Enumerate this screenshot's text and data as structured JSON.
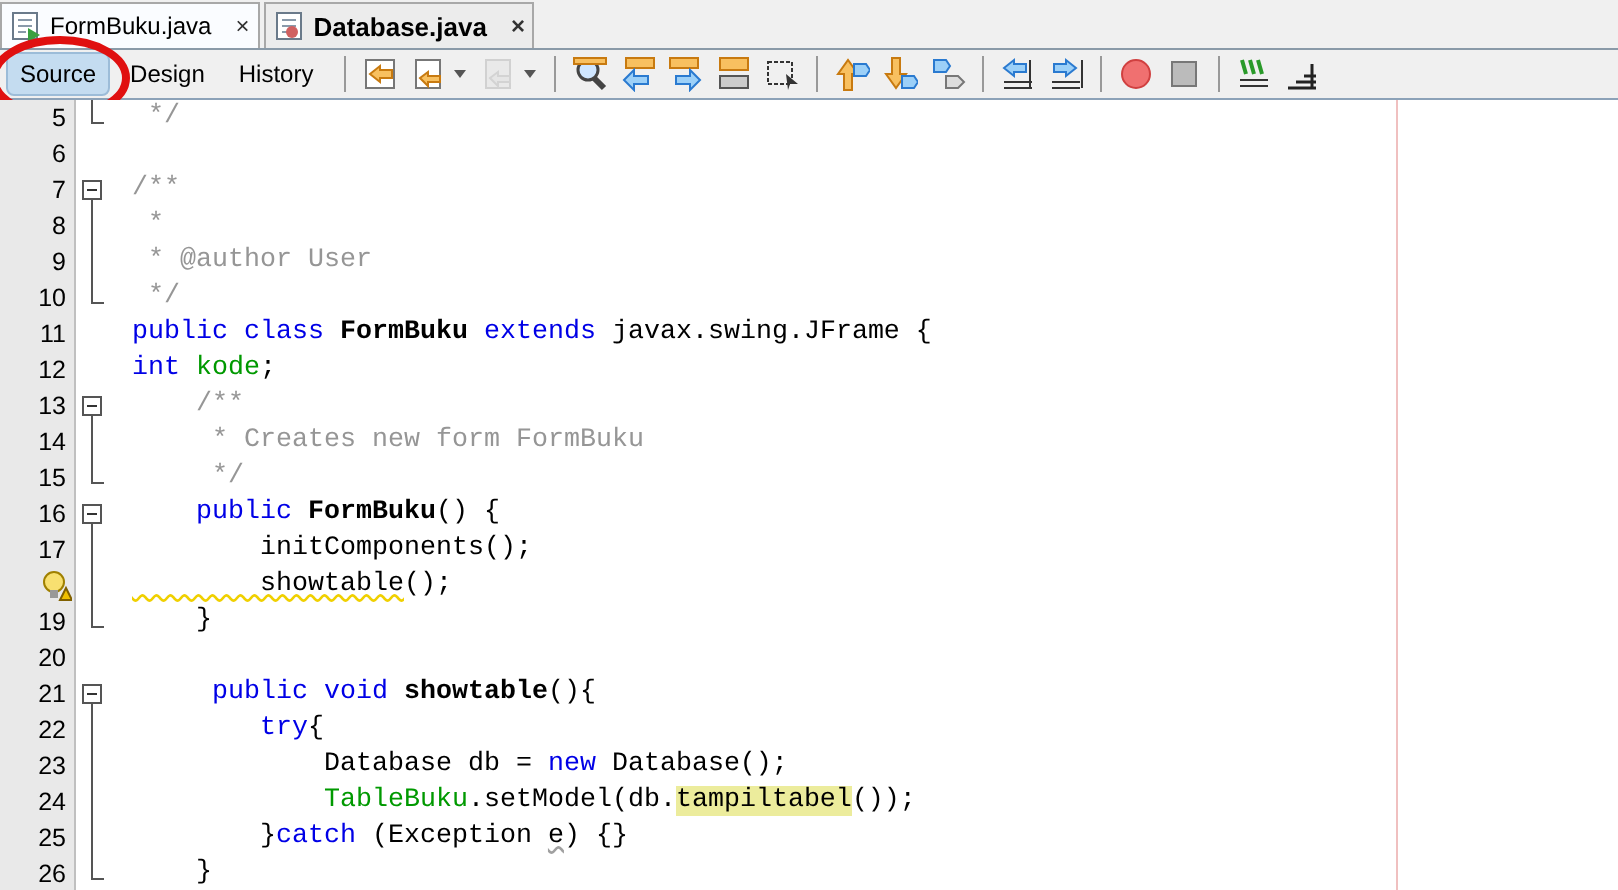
{
  "tabs": [
    {
      "label": "FormBuku.java",
      "selected": true,
      "modified": false,
      "close": "×"
    },
    {
      "label": "Database.java",
      "selected": false,
      "modified": true,
      "close": "×"
    }
  ],
  "views": [
    {
      "label": "Source",
      "selected": true
    },
    {
      "label": "Design",
      "selected": false
    },
    {
      "label": "History",
      "selected": false
    }
  ],
  "toolbar": [
    {
      "kind": "back",
      "disabled": false
    },
    {
      "kind": "prev-edit",
      "disabled": false,
      "dropdown": true
    },
    {
      "kind": "next-edit",
      "disabled": true,
      "dropdown": true
    },
    {
      "kind": "sep"
    },
    {
      "kind": "find",
      "disabled": false
    },
    {
      "kind": "find-prev",
      "disabled": false
    },
    {
      "kind": "find-next",
      "disabled": false
    },
    {
      "kind": "highlight",
      "disabled": false
    },
    {
      "kind": "select",
      "disabled": false
    },
    {
      "kind": "sep"
    },
    {
      "kind": "bm-prev",
      "disabled": false
    },
    {
      "kind": "bm-next",
      "disabled": false
    },
    {
      "kind": "bm-toggle",
      "disabled": false
    },
    {
      "kind": "sep"
    },
    {
      "kind": "shift-left",
      "disabled": false
    },
    {
      "kind": "shift-right",
      "disabled": false
    },
    {
      "kind": "sep"
    },
    {
      "kind": "record",
      "disabled": false
    },
    {
      "kind": "stop",
      "disabled": false
    },
    {
      "kind": "sep"
    },
    {
      "kind": "comment",
      "disabled": false
    },
    {
      "kind": "uncomment",
      "disabled": false
    }
  ],
  "lines": [
    {
      "number": "5",
      "kind": "fold-end",
      "tokens": [
        {
          "kind": "comment",
          "text": " */"
        }
      ]
    },
    {
      "number": "6"
    },
    {
      "number": "7",
      "kind": "fold-start",
      "tokens": [
        {
          "kind": "comment",
          "text": "/**"
        }
      ]
    },
    {
      "number": "8",
      "kind": "fold-line",
      "tokens": [
        {
          "kind": "comment",
          "text": " *"
        }
      ]
    },
    {
      "number": "9",
      "kind": "fold-line",
      "tokens": [
        {
          "kind": "comment",
          "text": " * @author User"
        }
      ]
    },
    {
      "number": "10",
      "kind": "fold-end",
      "tokens": [
        {
          "kind": "comment",
          "text": " */"
        }
      ]
    },
    {
      "number": "11",
      "tokens": [
        {
          "kind": "keyword",
          "text": "public class "
        },
        {
          "kind": "name",
          "text": "FormBuku "
        },
        {
          "kind": "keyword",
          "text": "extends"
        },
        {
          "kind": "plain",
          "text": " javax.swing.JFrame {"
        }
      ]
    },
    {
      "number": "12",
      "tokens": [
        {
          "kind": "keyword",
          "text": "int "
        },
        {
          "kind": "field",
          "text": "kode"
        },
        {
          "kind": "plain",
          "text": ";"
        }
      ]
    },
    {
      "number": "13",
      "kind": "fold-start",
      "tokens": [
        {
          "kind": "comment",
          "text": "    /**"
        }
      ]
    },
    {
      "number": "14",
      "kind": "fold-line",
      "tokens": [
        {
          "kind": "comment",
          "text": "     * Creates new form FormBuku"
        }
      ]
    },
    {
      "number": "15",
      "kind": "fold-end",
      "tokens": [
        {
          "kind": "comment",
          "text": "     */"
        }
      ]
    },
    {
      "number": "16",
      "kind": "fold-start",
      "tokens": [
        {
          "kind": "keyword",
          "text": "    public "
        },
        {
          "kind": "name",
          "text": "FormBuku"
        },
        {
          "kind": "plain",
          "text": "() {"
        }
      ]
    },
    {
      "number": "17",
      "kind": "fold-line",
      "tokens": [
        {
          "kind": "plain",
          "text": "        initComponents();"
        }
      ]
    },
    {
      "hint": true,
      "kind": "fold-line",
      "tokens": [
        {
          "kind": "warning",
          "text": "        showtable"
        },
        {
          "kind": "plain",
          "text": "();"
        }
      ]
    },
    {
      "number": "19",
      "kind": "fold-end",
      "tokens": [
        {
          "kind": "plain",
          "text": "    }"
        }
      ]
    },
    {
      "number": "20"
    },
    {
      "number": "21",
      "kind": "fold-start",
      "tokens": [
        {
          "kind": "keyword",
          "text": "     public void "
        },
        {
          "kind": "name",
          "text": "showtable"
        },
        {
          "kind": "plain",
          "text": "(){"
        }
      ]
    },
    {
      "number": "22",
      "kind": "fold-line",
      "tokens": [
        {
          "kind": "keyword",
          "text": "        try"
        },
        {
          "kind": "plain",
          "text": "{"
        }
      ]
    },
    {
      "number": "23",
      "kind": "fold-line",
      "tokens": [
        {
          "kind": "plain",
          "text": "            Database db = "
        },
        {
          "kind": "keyword",
          "text": "new"
        },
        {
          "kind": "plain",
          "text": " Database();"
        }
      ]
    },
    {
      "number": "24",
      "kind": "fold-line",
      "tokens": [
        {
          "kind": "field",
          "text": "            TableBuku"
        },
        {
          "kind": "plain",
          "text": ".setModel(db."
        },
        {
          "kind": "highlight",
          "text": "tampiltabel"
        },
        {
          "kind": "plain",
          "text": "());"
        }
      ]
    },
    {
      "number": "25",
      "kind": "fold-line",
      "tokens": [
        {
          "kind": "plain",
          "text": "        }"
        },
        {
          "kind": "keyword",
          "text": "catch"
        },
        {
          "kind": "plain",
          "text": " (Exception "
        },
        {
          "kind": "unused",
          "text": "e"
        },
        {
          "kind": "plain",
          "text": ") {}"
        }
      ]
    },
    {
      "number": "26",
      "kind": "fold-end",
      "tokens": [
        {
          "kind": "plain",
          "text": "    }"
        }
      ]
    }
  ]
}
